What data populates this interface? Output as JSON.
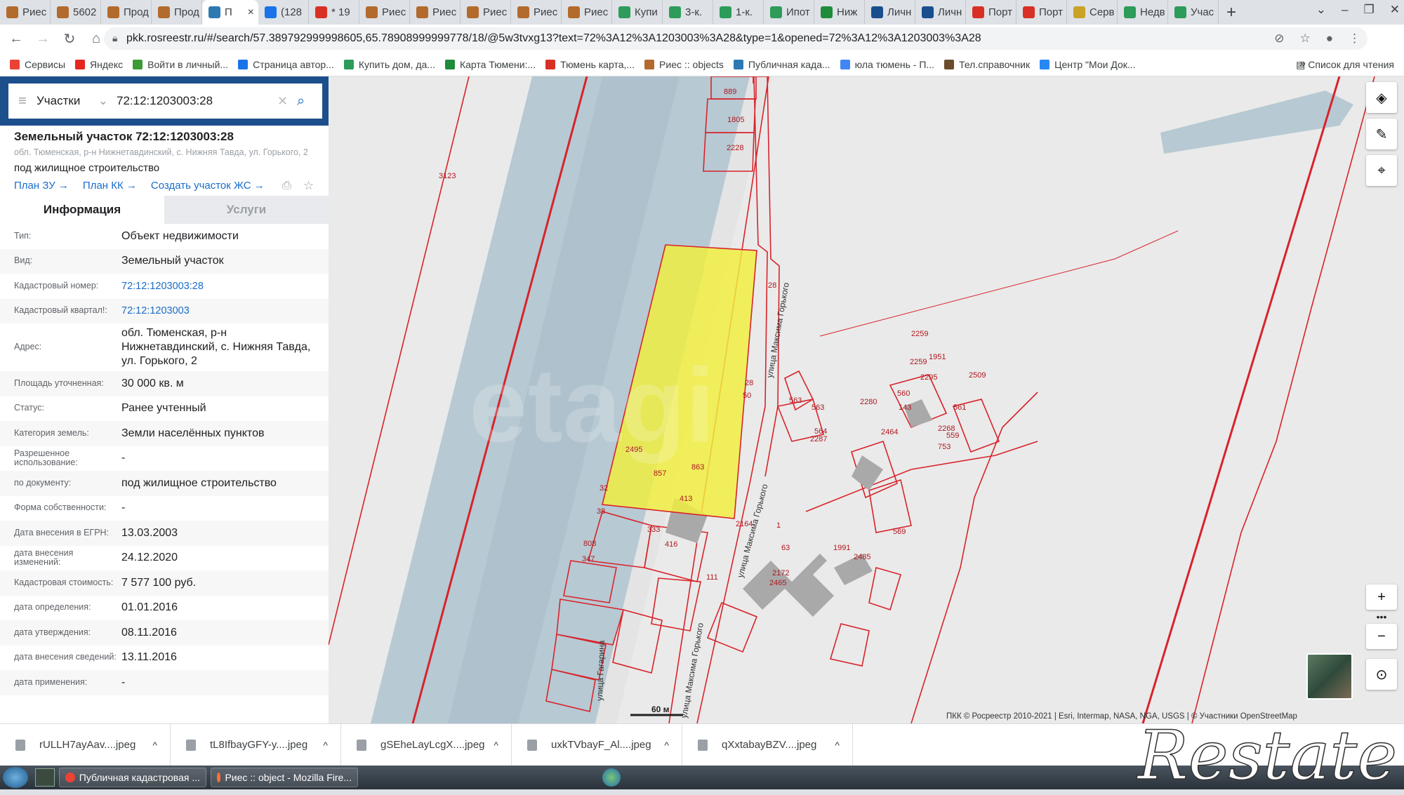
{
  "browser": {
    "tabs": [
      {
        "label": "Риес",
        "color": "#b36b2d"
      },
      {
        "label": "5602",
        "color": "#b36b2d"
      },
      {
        "label": "Прод",
        "color": "#b36b2d"
      },
      {
        "label": "Прод",
        "color": "#b36b2d"
      },
      {
        "label": "П",
        "color": "#2d7ab3",
        "active": true
      },
      {
        "label": "(128",
        "color": "#1a73e8"
      },
      {
        "label": "* 19",
        "color": "#d93025"
      },
      {
        "label": "Риес",
        "color": "#b36b2d"
      },
      {
        "label": "Риес",
        "color": "#b36b2d"
      },
      {
        "label": "Риес",
        "color": "#b36b2d"
      },
      {
        "label": "Риес",
        "color": "#b36b2d"
      },
      {
        "label": "Риес",
        "color": "#b36b2d"
      },
      {
        "label": "Купи",
        "color": "#2d9b5a"
      },
      {
        "label": "3-к.",
        "color": "#2d9b5a"
      },
      {
        "label": "1-к.",
        "color": "#2d9b5a"
      },
      {
        "label": "Ипот",
        "color": "#2d9b5a"
      },
      {
        "label": "Ниж",
        "color": "#1e8c3a"
      },
      {
        "label": "Личн",
        "color": "#1a4f8c"
      },
      {
        "label": "Личн",
        "color": "#1a4f8c"
      },
      {
        "label": "Порт",
        "color": "#d93025"
      },
      {
        "label": "Порт",
        "color": "#d93025"
      },
      {
        "label": "Серв",
        "color": "#c9a227"
      },
      {
        "label": "Недв",
        "color": "#2d9b5a"
      },
      {
        "label": "Учас",
        "color": "#2d9b5a"
      }
    ],
    "new_tab": "+",
    "url": "pkk.rosreestr.ru/#/search/57.389792999998605,65.78908999999778/18/@5w3tvxg13?text=72%3A12%3A1203003%3A28&type=1&opened=72%3A12%3A1203003%3A28",
    "bookmarks": [
      {
        "label": "Сервисы",
        "color": "#ea4335"
      },
      {
        "label": "Яндекс",
        "color": "#e52620"
      },
      {
        "label": "Войти в личный...",
        "color": "#3d9b35"
      },
      {
        "label": "Страница автор...",
        "color": "#1a73e8"
      },
      {
        "label": "Купить дом, да...",
        "color": "#2d9b5a"
      },
      {
        "label": "Карта Тюмени:...",
        "color": "#1e8c3a"
      },
      {
        "label": "Тюмень карта,...",
        "color": "#d93025"
      },
      {
        "label": "Риес :: objects",
        "color": "#b36b2d"
      },
      {
        "label": "Публичная када...",
        "color": "#2d7ab3"
      },
      {
        "label": "юла тюмень - П...",
        "color": "#4285f4"
      },
      {
        "label": "Тел.справочник",
        "color": "#6b4c2d"
      },
      {
        "label": "Центр \"Мои Док...",
        "color": "#2787f5"
      }
    ],
    "reading_list": "Список для чтения"
  },
  "search": {
    "category": "Участки",
    "query": "72:12:1203003:28"
  },
  "parcel": {
    "title": "Земельный участок 72:12:1203003:28",
    "address_short": "обл. Тюменская, р-н Нижнетавдинский, с. Нижняя Тавда, ул. Горького, 2",
    "usage": "под жилищное строительство",
    "links": [
      "План ЗУ",
      "План КК",
      "Создать участок ЖС"
    ],
    "tab_info": "Информация",
    "tab_services": "Услуги",
    "rows": [
      {
        "label": "Тип:",
        "value": "Объект недвижимости"
      },
      {
        "label": "Вид:",
        "value": "Земельный участок"
      },
      {
        "label": "Кадастровый номер:",
        "value": "72:12:1203003:28",
        "link": true
      },
      {
        "label": "Кадастровый квартал!:",
        "value": "72:12:1203003",
        "link": true
      },
      {
        "label": "Адрес:",
        "value": "обл. Тюменская, р-н Нижнетавдинский, с. Нижняя Тавда, ул. Горького, 2"
      },
      {
        "label": "Площадь уточненная:",
        "value": "30 000 кв. м"
      },
      {
        "label": "Статус:",
        "value": "Ранее учтенный"
      },
      {
        "label": "Категория земель:",
        "value": "Земли населённых пунктов"
      },
      {
        "label": "Разрешенное использование:",
        "value": "-"
      },
      {
        "label": "по документу:",
        "value": "под жилищное строительство"
      },
      {
        "label": "Форма собственности:",
        "value": "-"
      },
      {
        "label": "Дата внесения в ЕГРН:",
        "value": "13.03.2003"
      },
      {
        "label": "дата внесения изменений:",
        "value": "24.12.2020"
      },
      {
        "label": "Кадастровая стоимость:",
        "value": "7 577 100 руб."
      },
      {
        "label": "дата определения:",
        "value": "01.01.2016"
      },
      {
        "label": "дата утверждения:",
        "value": "08.11.2016"
      },
      {
        "label": "дата внесения сведений:",
        "value": "13.11.2016"
      },
      {
        "label": "дата применения:",
        "value": "-"
      }
    ]
  },
  "map": {
    "parcel_labels": [
      "889",
      "1805",
      "2228",
      "3123",
      "28",
      "28",
      "563",
      "563",
      "564",
      "2287",
      "50",
      "2259",
      "2259",
      "1951",
      "2509",
      "2295",
      "560",
      "561",
      "2280",
      "143",
      "2268",
      "559",
      "753",
      "2464",
      "2495",
      "863",
      "857",
      "32",
      "413",
      "38",
      "333",
      "808",
      "347",
      "416",
      "2164",
      "1",
      "63",
      "569",
      "1991",
      "2485",
      "2172",
      "2465",
      "111"
    ],
    "streets": [
      "улица Максима Горького",
      "улица Максима Горького",
      "улица Максима Горького",
      "улица Гагарина"
    ],
    "scale": "60 м",
    "attribution": "ПКК © Росреестр 2010-2021 | Esri, Intermap, NASA, NGA, USGS | © Участники OpenStreetMap",
    "watermark": "etagi",
    "highlight_color": "#f2ef3c",
    "border_color": "#d8232a",
    "water_color": "#b7c9d3"
  },
  "downloads": [
    "rULLH7ayAav....jpeg",
    "tL8IfbayGFY-y....jpeg",
    "gSEheLayLcgX....jpeg",
    "uxkTVbayF_Al....jpeg",
    "qXxtabayBZV....jpeg"
  ],
  "taskbar": {
    "items": [
      "Публичная кадастровая ...",
      "Риес :: object - Mozilla Fire..."
    ]
  },
  "corner_watermark": "Restate"
}
